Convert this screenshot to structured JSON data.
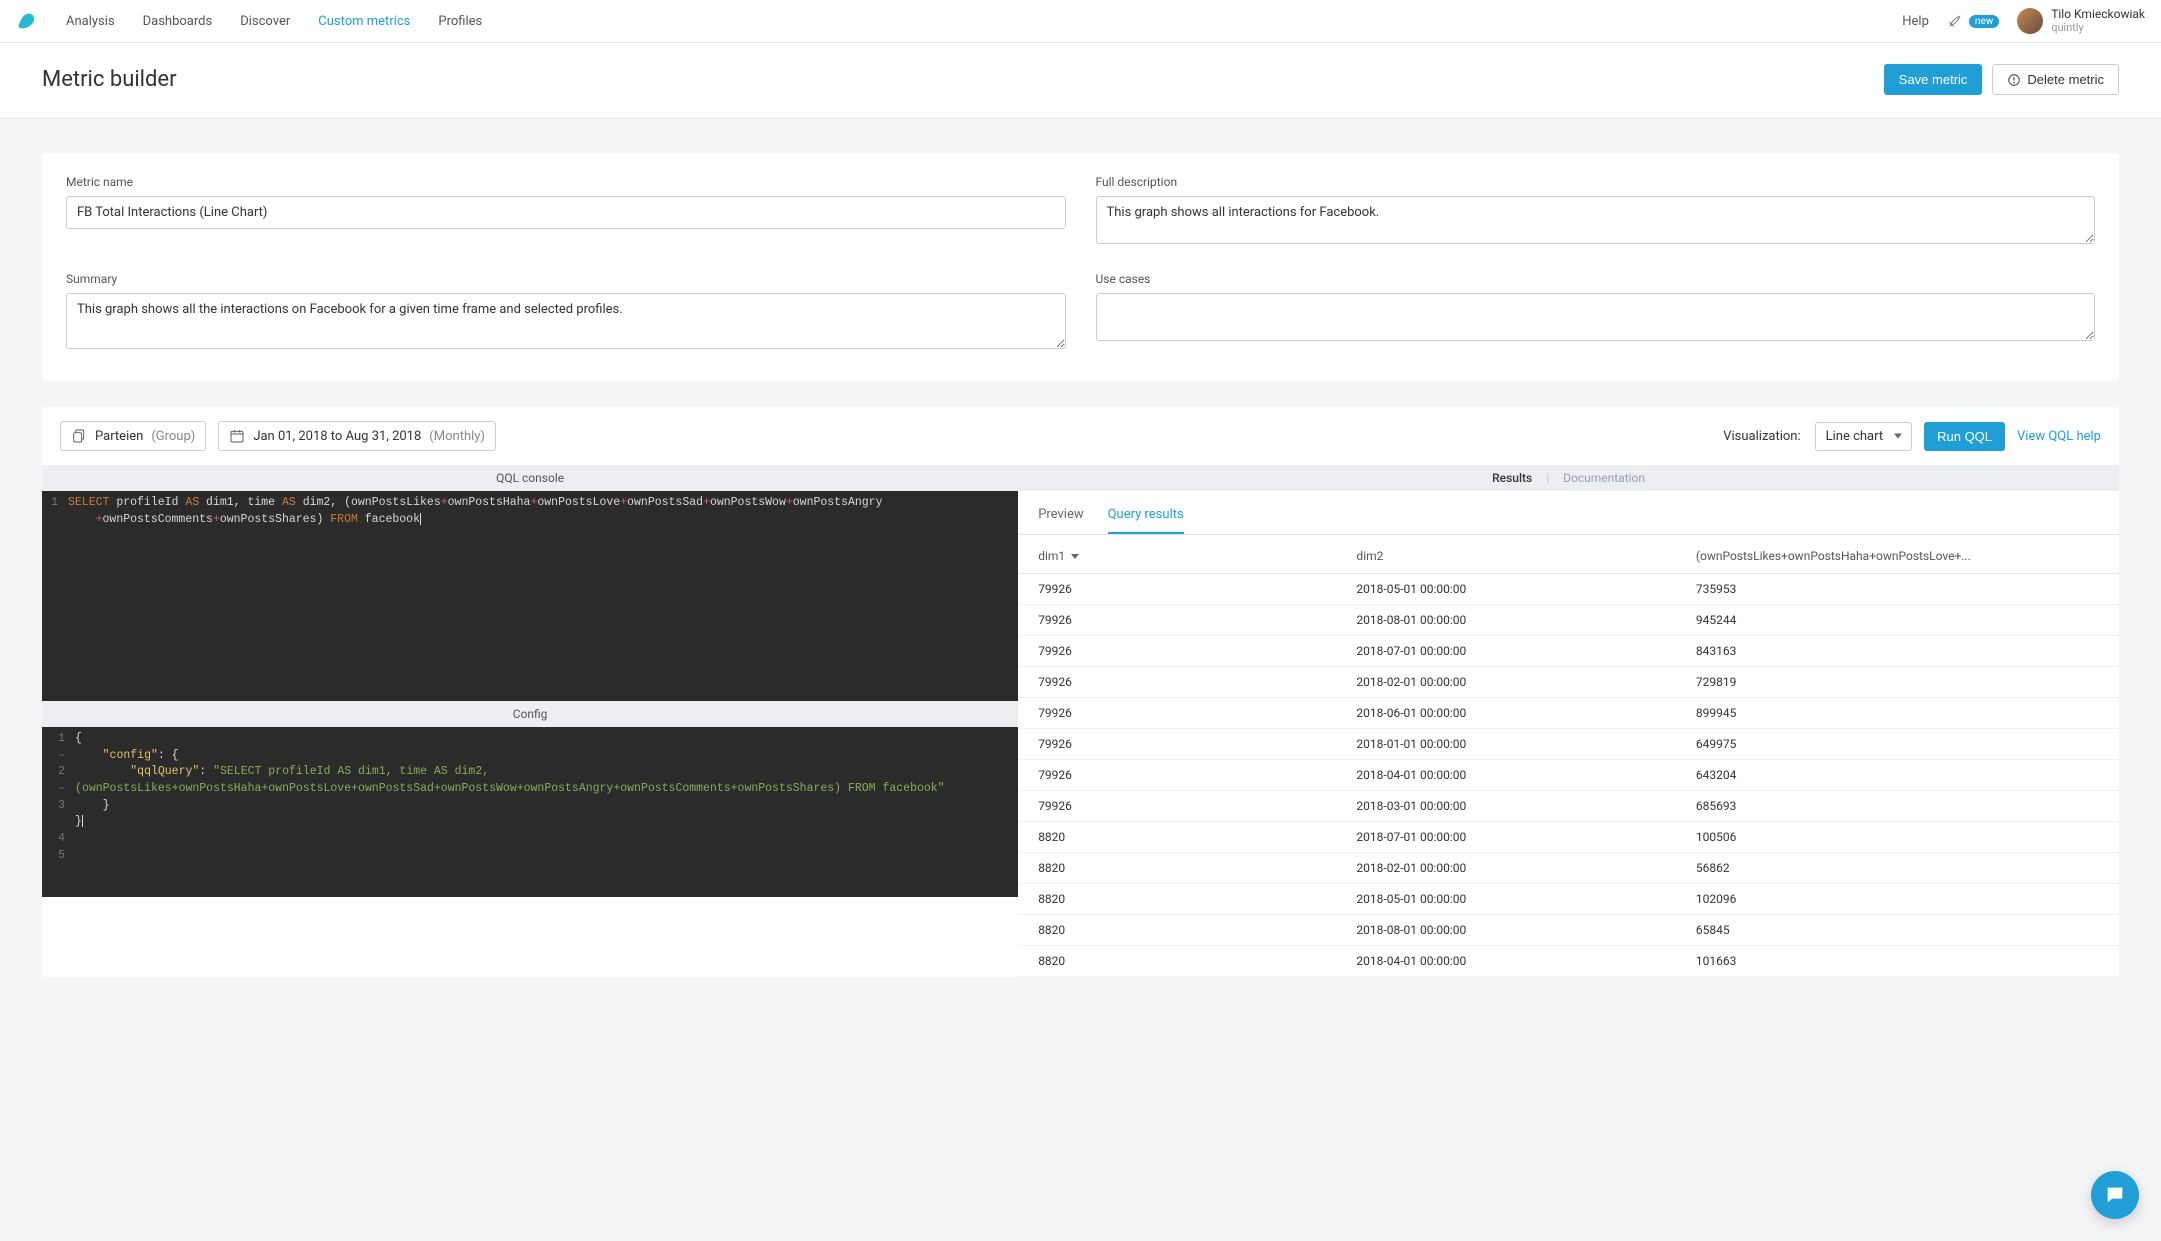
{
  "nav": {
    "items": [
      "Analysis",
      "Dashboards",
      "Discover",
      "Custom metrics",
      "Profiles"
    ],
    "active_index": 3,
    "help": "Help",
    "new_badge": "new",
    "user_name": "Tilo Kmieckowiak",
    "user_org": "quintly"
  },
  "page": {
    "title": "Metric builder",
    "save_btn": "Save metric",
    "delete_btn": "Delete metric"
  },
  "form": {
    "metric_name_label": "Metric name",
    "metric_name_value": "FB Total Interactions (Line Chart)",
    "summary_label": "Summary",
    "summary_value": "This graph shows all the interactions on Facebook for a given time frame and selected profiles.",
    "description_label": "Full description",
    "description_value": "This graph shows all interactions for Facebook.",
    "usecases_label": "Use cases",
    "usecases_value": ""
  },
  "controls": {
    "group_name": "Parteien",
    "group_type": "(Group)",
    "date_range": "Jan 01, 2018 to Aug 31, 2018",
    "date_interval": "(Monthly)",
    "vis_label": "Visualization:",
    "vis_value": "Line chart",
    "run_btn": "Run QQL",
    "view_help": "View QQL help"
  },
  "panels": {
    "qql_header": "QQL console",
    "config_header": "Config",
    "results_label": "Results",
    "docs_label": "Documentation"
  },
  "qql": {
    "line1_select": "SELECT",
    "line1_body1": " profileId ",
    "line1_as1": "AS",
    "line1_body2": " dim1, time ",
    "line1_as2": "AS",
    "line1_body3": " dim2, (ownPostsLikes",
    "op": "+",
    "t1": "ownPostsHaha",
    "t2": "ownPostsLove",
    "t3": "ownPostsSad",
    "t4": "ownPostsWow",
    "t5": "ownPostsAngry",
    "line2_pre": "    ",
    "t6": "ownPostsComments",
    "t7": "ownPostsShares) ",
    "from": "FROM",
    "table": " facebook"
  },
  "config": {
    "key_config": "\"config\"",
    "key_qql": "\"qqlQuery\"",
    "value": "\"SELECT profileId AS dim1, time AS dim2, (ownPostsLikes+ownPostsHaha+ownPostsLove+ownPostsSad+ownPostsWow+ownPostsAngry+ownPostsComments+ownPostsShares) FROM facebook\""
  },
  "results": {
    "tabs": {
      "preview": "Preview",
      "query": "Query results",
      "active": "query"
    },
    "columns": [
      "dim1",
      "dim2",
      "(ownPostsLikes+ownPostsHaha+ownPostsLove+..."
    ],
    "rows": [
      [
        "79926",
        "2018-05-01 00:00:00",
        "735953"
      ],
      [
        "79926",
        "2018-08-01 00:00:00",
        "945244"
      ],
      [
        "79926",
        "2018-07-01 00:00:00",
        "843163"
      ],
      [
        "79926",
        "2018-02-01 00:00:00",
        "729819"
      ],
      [
        "79926",
        "2018-06-01 00:00:00",
        "899945"
      ],
      [
        "79926",
        "2018-01-01 00:00:00",
        "649975"
      ],
      [
        "79926",
        "2018-04-01 00:00:00",
        "643204"
      ],
      [
        "79926",
        "2018-03-01 00:00:00",
        "685693"
      ],
      [
        "8820",
        "2018-07-01 00:00:00",
        "100506"
      ],
      [
        "8820",
        "2018-02-01 00:00:00",
        "56862"
      ],
      [
        "8820",
        "2018-05-01 00:00:00",
        "102096"
      ],
      [
        "8820",
        "2018-08-01 00:00:00",
        "65845"
      ],
      [
        "8820",
        "2018-04-01 00:00:00",
        "101663"
      ]
    ]
  }
}
